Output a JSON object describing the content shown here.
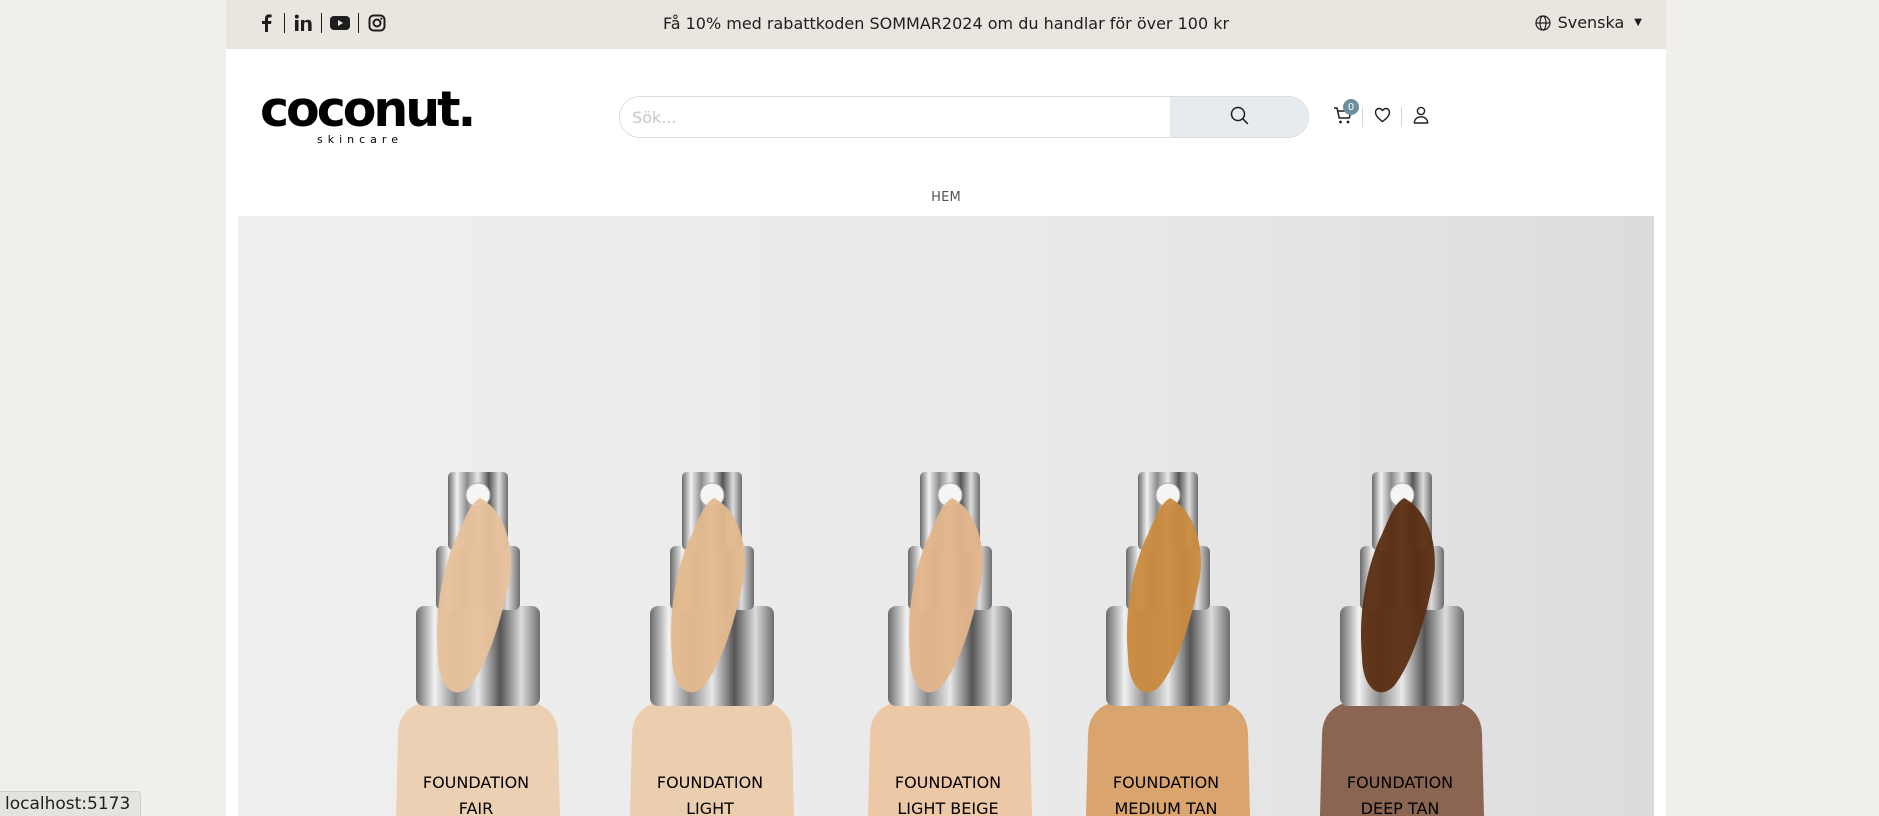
{
  "topbar": {
    "promo": "Få 10% med rabattkoden SOMMAR2024 om du handlar för över 100 kr",
    "language": "Svenska",
    "social": [
      "facebook-icon",
      "linkedin-icon",
      "youtube-icon",
      "instagram-icon"
    ]
  },
  "header": {
    "logo_main": "coconut.",
    "logo_sub": "skincare",
    "search_placeholder": "Sök...",
    "cart_count": "0"
  },
  "nav": {
    "items": [
      "HEM"
    ]
  },
  "hero": {
    "bottles": [
      {
        "line1": "FOUNDATION",
        "line2": "FAIR",
        "liquid": "#e7c19c",
        "glass": "#ecd0b4"
      },
      {
        "line1": "FOUNDATION",
        "line2": "LIGHT",
        "liquid": "#e4b98e",
        "glass": "#ebcdb0"
      },
      {
        "line1": "FOUNDATION",
        "line2": "LIGHT BEIGE",
        "liquid": "#e3b58c",
        "glass": "#ecc8a6"
      },
      {
        "line1": "FOUNDATION",
        "line2": "MEDIUM TAN",
        "liquid": "#c98a3e",
        "glass": "#d9a46e"
      },
      {
        "line1": "FOUNDATION",
        "line2": "DEEP TAN",
        "liquid": "#5a2d12",
        "glass": "#8a6552"
      }
    ]
  },
  "status_bar": "localhost:5173"
}
